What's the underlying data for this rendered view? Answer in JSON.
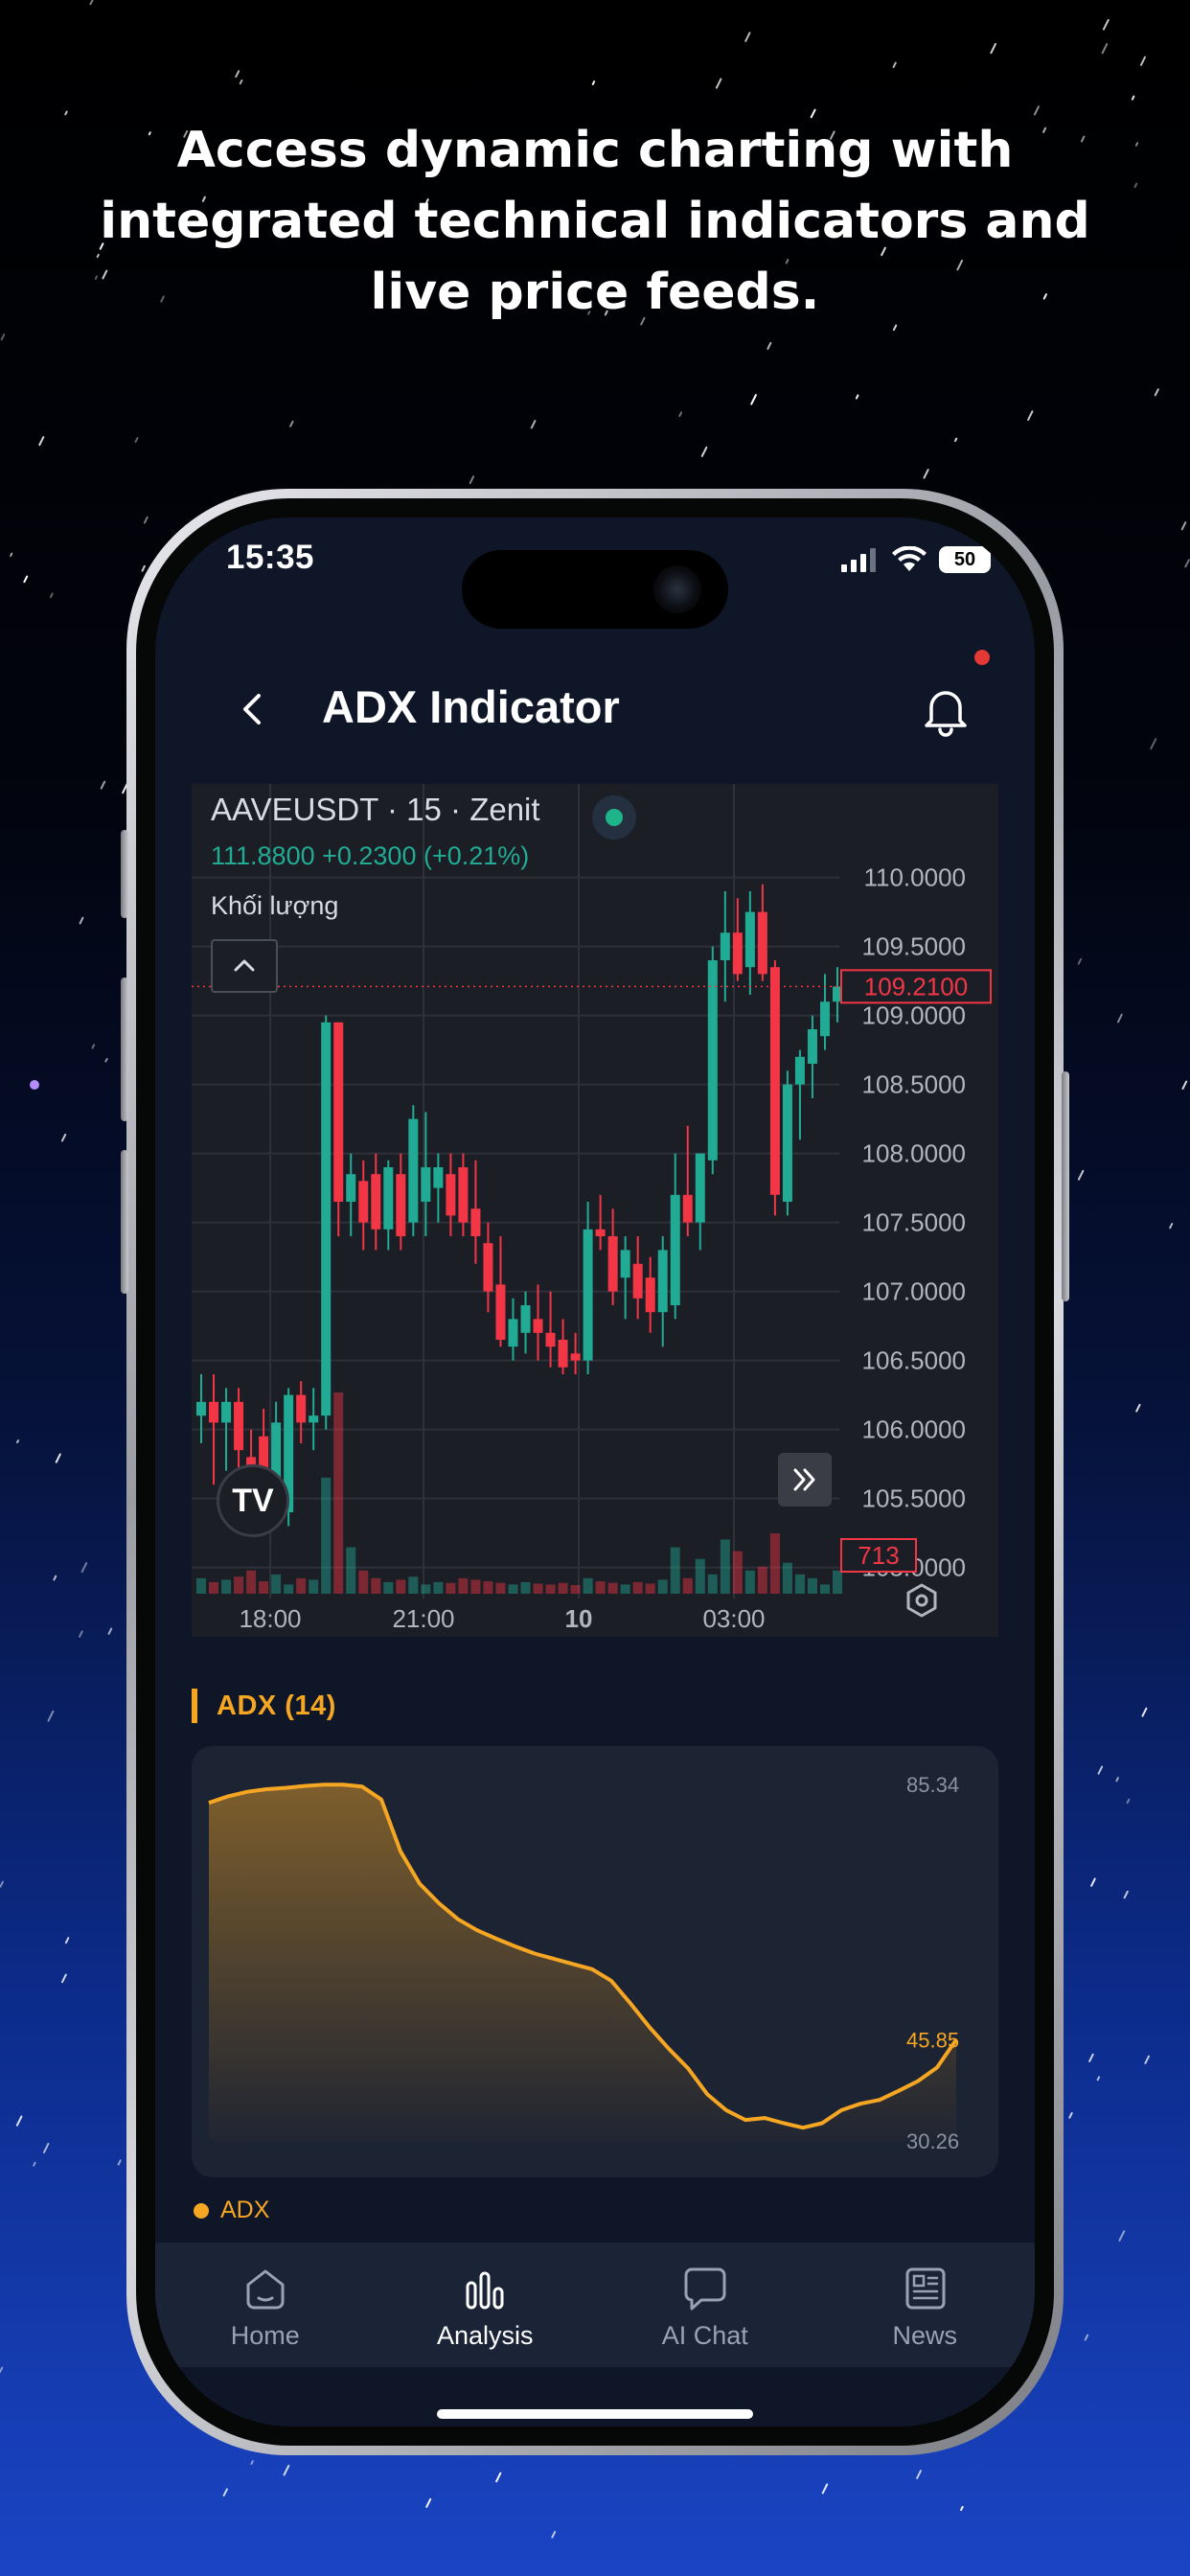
{
  "headline": "Access dynamic charting with integrated technical indicators and live price feeds.",
  "status_bar": {
    "time": "15:35",
    "battery": "50"
  },
  "app_bar": {
    "title": "ADX Indicator"
  },
  "price_chart": {
    "title": "AAVEUSDT · 15 · Zenit",
    "quote": "111.8800  +0.2300 (+0.21%)",
    "volume_label": "Khối lượng",
    "current_price": "109.2100",
    "current_volume": "713",
    "logo_text": "TV",
    "colors": {
      "up": "#22ab94",
      "down": "#f23645"
    }
  },
  "adx_section": {
    "title": "ADX (14)",
    "legend": "ADX",
    "color": "#f5a623"
  },
  "chart_data": [
    {
      "type": "candlestick",
      "title": "AAVEUSDT · 15 · Zenit",
      "y_ticks": [
        "110.0000",
        "109.5000",
        "109.0000",
        "108.5000",
        "108.0000",
        "107.5000",
        "107.0000",
        "106.5000",
        "106.0000",
        "105.5000",
        "105.0000"
      ],
      "ylim": [
        104.9,
        110.4
      ],
      "x_ticks": [
        "18:00",
        "21:00",
        "10",
        "03:00"
      ],
      "grid": true,
      "last_price": 109.21,
      "last_volume": 713,
      "candles": [
        {
          "o": 106.1,
          "h": 106.4,
          "l": 105.9,
          "c": 106.2
        },
        {
          "o": 106.2,
          "h": 106.4,
          "l": 105.6,
          "c": 106.05
        },
        {
          "o": 106.05,
          "h": 106.3,
          "l": 105.7,
          "c": 106.2
        },
        {
          "o": 106.2,
          "h": 106.3,
          "l": 105.7,
          "c": 105.85
        },
        {
          "o": 105.8,
          "h": 106.0,
          "l": 105.3,
          "c": 105.4
        },
        {
          "o": 105.95,
          "h": 106.15,
          "l": 105.4,
          "c": 105.45
        },
        {
          "o": 105.5,
          "h": 106.2,
          "l": 105.3,
          "c": 106.05
        },
        {
          "o": 105.4,
          "h": 106.3,
          "l": 105.3,
          "c": 106.25
        },
        {
          "o": 106.25,
          "h": 106.35,
          "l": 105.9,
          "c": 106.05
        },
        {
          "o": 106.05,
          "h": 106.3,
          "l": 105.85,
          "c": 106.1
        },
        {
          "o": 106.1,
          "h": 109.0,
          "l": 106.0,
          "c": 108.95
        },
        {
          "o": 108.95,
          "h": 108.95,
          "l": 107.4,
          "c": 107.65
        },
        {
          "o": 107.65,
          "h": 108.0,
          "l": 107.4,
          "c": 107.85
        },
        {
          "o": 107.8,
          "h": 107.95,
          "l": 107.3,
          "c": 107.5
        },
        {
          "o": 107.85,
          "h": 108.0,
          "l": 107.3,
          "c": 107.45
        },
        {
          "o": 107.45,
          "h": 107.95,
          "l": 107.3,
          "c": 107.9
        },
        {
          "o": 107.85,
          "h": 108.0,
          "l": 107.3,
          "c": 107.4
        },
        {
          "o": 107.5,
          "h": 108.35,
          "l": 107.4,
          "c": 108.25
        },
        {
          "o": 107.65,
          "h": 108.3,
          "l": 107.4,
          "c": 107.9
        },
        {
          "o": 107.75,
          "h": 108.0,
          "l": 107.5,
          "c": 107.9
        },
        {
          "o": 107.85,
          "h": 108.0,
          "l": 107.4,
          "c": 107.55
        },
        {
          "o": 107.9,
          "h": 108.0,
          "l": 107.4,
          "c": 107.5
        },
        {
          "o": 107.6,
          "h": 107.95,
          "l": 107.2,
          "c": 107.4
        },
        {
          "o": 107.35,
          "h": 107.5,
          "l": 106.85,
          "c": 107.0
        },
        {
          "o": 107.05,
          "h": 107.4,
          "l": 106.6,
          "c": 106.65
        },
        {
          "o": 106.6,
          "h": 106.95,
          "l": 106.5,
          "c": 106.8
        },
        {
          "o": 106.7,
          "h": 107.0,
          "l": 106.55,
          "c": 106.9
        },
        {
          "o": 106.8,
          "h": 107.05,
          "l": 106.5,
          "c": 106.7
        },
        {
          "o": 106.7,
          "h": 107.0,
          "l": 106.45,
          "c": 106.6
        },
        {
          "o": 106.65,
          "h": 106.8,
          "l": 106.4,
          "c": 106.45
        },
        {
          "o": 106.55,
          "h": 106.7,
          "l": 106.4,
          "c": 106.5
        },
        {
          "o": 106.5,
          "h": 107.65,
          "l": 106.4,
          "c": 107.45
        },
        {
          "o": 107.45,
          "h": 107.7,
          "l": 107.3,
          "c": 107.4
        },
        {
          "o": 107.4,
          "h": 107.6,
          "l": 106.9,
          "c": 107.0
        },
        {
          "o": 107.1,
          "h": 107.4,
          "l": 106.8,
          "c": 107.3
        },
        {
          "o": 107.2,
          "h": 107.4,
          "l": 106.8,
          "c": 106.95
        },
        {
          "o": 107.1,
          "h": 107.25,
          "l": 106.7,
          "c": 106.85
        },
        {
          "o": 106.85,
          "h": 107.4,
          "l": 106.6,
          "c": 107.3
        },
        {
          "o": 106.9,
          "h": 108.0,
          "l": 106.8,
          "c": 107.7
        },
        {
          "o": 107.7,
          "h": 108.2,
          "l": 107.4,
          "c": 107.5
        },
        {
          "o": 107.5,
          "h": 108.0,
          "l": 107.3,
          "c": 108.0
        },
        {
          "o": 107.95,
          "h": 109.5,
          "l": 107.85,
          "c": 109.4
        },
        {
          "o": 109.4,
          "h": 109.9,
          "l": 109.1,
          "c": 109.6
        },
        {
          "o": 109.6,
          "h": 109.85,
          "l": 109.25,
          "c": 109.3
        },
        {
          "o": 109.35,
          "h": 109.9,
          "l": 109.15,
          "c": 109.75
        },
        {
          "o": 109.75,
          "h": 109.95,
          "l": 109.25,
          "c": 109.3
        },
        {
          "o": 109.35,
          "h": 109.4,
          "l": 107.55,
          "c": 107.7
        },
        {
          "o": 107.65,
          "h": 108.6,
          "l": 107.55,
          "c": 108.5
        },
        {
          "o": 108.5,
          "h": 108.75,
          "l": 108.1,
          "c": 108.7
        },
        {
          "o": 108.65,
          "h": 109.0,
          "l": 108.4,
          "c": 108.9
        },
        {
          "o": 108.85,
          "h": 109.3,
          "l": 108.75,
          "c": 109.1
        },
        {
          "o": 109.1,
          "h": 109.35,
          "l": 108.95,
          "c": 109.21
        }
      ],
      "volumes": [
        20,
        15,
        18,
        22,
        30,
        16,
        25,
        12,
        20,
        18,
        150,
        260,
        60,
        30,
        20,
        15,
        18,
        22,
        12,
        15,
        14,
        20,
        18,
        16,
        14,
        12,
        15,
        13,
        12,
        14,
        11,
        20,
        16,
        14,
        12,
        15,
        13,
        18,
        60,
        20,
        45,
        25,
        70,
        55,
        30,
        35,
        78,
        40,
        25,
        20,
        12,
        30
      ]
    },
    {
      "type": "area",
      "title": "ADX (14)",
      "series": [
        {
          "name": "ADX",
          "values": [
            82.5,
            83.5,
            84.2,
            84.6,
            84.8,
            85.1,
            85.3,
            85.3,
            85.0,
            83.0,
            75.0,
            70.0,
            67.0,
            64.5,
            62.8,
            61.5,
            60.3,
            59.2,
            58.4,
            57.6,
            56.8,
            55.0,
            51.5,
            47.8,
            44.5,
            41.5,
            37.5,
            35.0,
            33.5,
            33.8,
            33.0,
            32.3,
            33.0,
            35.0,
            36.0,
            36.6,
            38.0,
            39.5,
            41.6,
            45.9
          ]
        }
      ],
      "y_ticks": [
        "85.34",
        "45.85",
        "30.26"
      ],
      "last_value": 45.85,
      "ylim": [
        30.26,
        85.34
      ]
    }
  ],
  "tab_bar": {
    "tabs": [
      {
        "label": "Home",
        "icon": "home-icon",
        "active": false
      },
      {
        "label": "Analysis",
        "icon": "bar-chart-icon",
        "active": true
      },
      {
        "label": "AI Chat",
        "icon": "chat-bubble-icon",
        "active": false
      },
      {
        "label": "News",
        "icon": "newspaper-icon",
        "active": false
      }
    ]
  }
}
